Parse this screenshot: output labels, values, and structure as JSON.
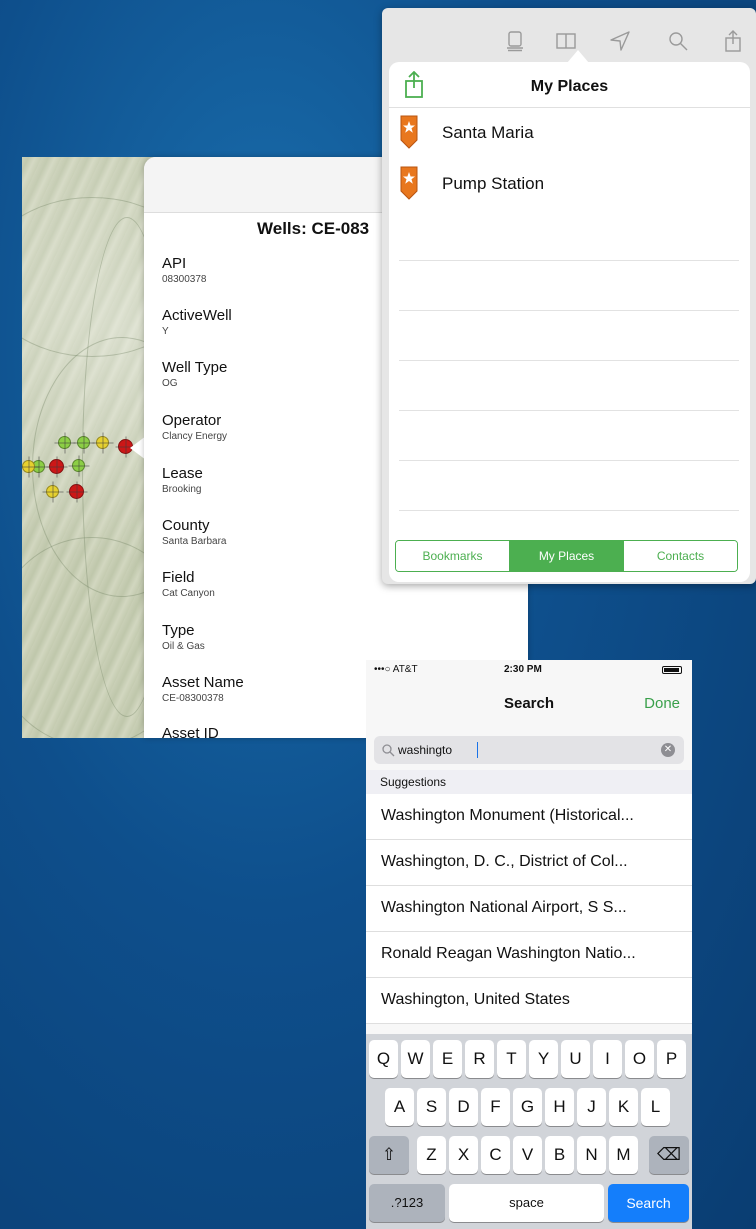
{
  "wells_popover": {
    "title": "Wells: CE-083",
    "attributes": [
      {
        "name": "API",
        "value": "08300378"
      },
      {
        "name": "ActiveWell",
        "value": "Y"
      },
      {
        "name": "Well Type",
        "value": "OG"
      },
      {
        "name": "Operator",
        "value": "Clancy Energy"
      },
      {
        "name": "Lease",
        "value": "Brooking"
      },
      {
        "name": "County",
        "value": "Santa Barbara"
      },
      {
        "name": "Field",
        "value": "Cat Canyon"
      },
      {
        "name": "Type",
        "value": "Oil & Gas"
      },
      {
        "name": "Asset Name",
        "value": "CE-08300378"
      },
      {
        "name": "Asset ID",
        "value": ""
      }
    ]
  },
  "places_panel": {
    "toolbar_icons": [
      "layers-icon",
      "book-icon",
      "location-arrow-icon",
      "search-icon",
      "share-icon"
    ],
    "title": "My Places",
    "share_icon": "share-icon",
    "places": [
      {
        "label": "Santa Maria",
        "icon": "place-pin-icon"
      },
      {
        "label": "Pump Station",
        "icon": "place-pin-icon"
      }
    ],
    "segments": [
      "Bookmarks",
      "My Places",
      "Contacts"
    ],
    "active_segment": "My Places",
    "accent_color": "#4caf50",
    "pin_color": "#e8771e"
  },
  "phone": {
    "status": {
      "carrier": "•••○ AT&T",
      "time": "2:30 PM"
    },
    "nav": {
      "title": "Search",
      "done_label": "Done"
    },
    "search": {
      "value": "washingto",
      "clear_icon": "clear-icon"
    },
    "suggestions_header": "Suggestions",
    "suggestions": [
      "Washington Monument (Historical...",
      "Washington, D. C., District of Col...",
      "Washington National Airport, S S...",
      "Ronald Reagan Washington Natio...",
      "Washington, United States"
    ],
    "keyboard": {
      "row1": [
        "Q",
        "W",
        "E",
        "R",
        "T",
        "Y",
        "U",
        "I",
        "O",
        "P"
      ],
      "row2": [
        "A",
        "S",
        "D",
        "F",
        "G",
        "H",
        "J",
        "K",
        "L"
      ],
      "row3": [
        "Z",
        "X",
        "C",
        "V",
        "B",
        "N",
        "M"
      ],
      "shift_icon": "shift-icon",
      "delete_icon": "delete-icon",
      "numbers_label": ".?123",
      "space_label": "space",
      "search_label": "Search"
    },
    "accent_done": "#3aa04b",
    "search_key_color": "#147efb"
  }
}
